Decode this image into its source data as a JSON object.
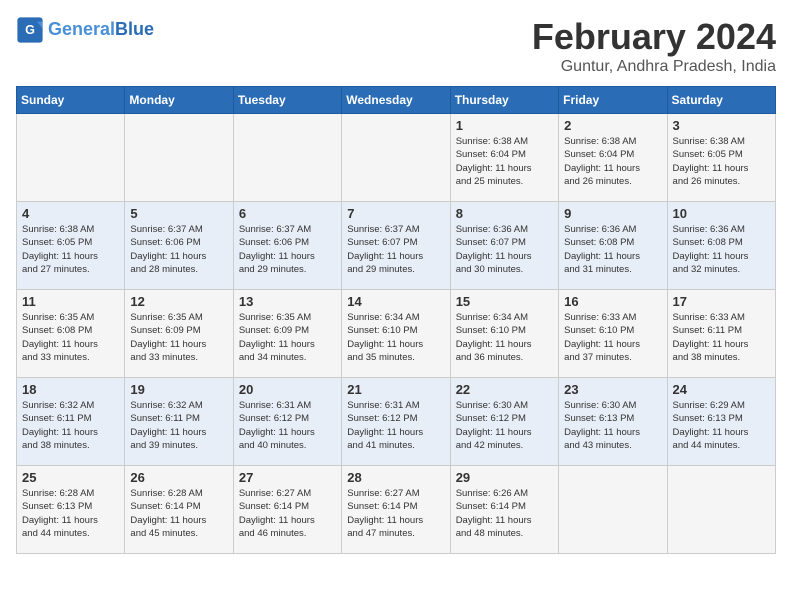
{
  "logo": {
    "text_general": "General",
    "text_blue": "Blue"
  },
  "title": "February 2024",
  "subtitle": "Guntur, Andhra Pradesh, India",
  "weekdays": [
    "Sunday",
    "Monday",
    "Tuesday",
    "Wednesday",
    "Thursday",
    "Friday",
    "Saturday"
  ],
  "weeks": [
    [
      {
        "day": "",
        "info": ""
      },
      {
        "day": "",
        "info": ""
      },
      {
        "day": "",
        "info": ""
      },
      {
        "day": "",
        "info": ""
      },
      {
        "day": "1",
        "info": "Sunrise: 6:38 AM\nSunset: 6:04 PM\nDaylight: 11 hours\nand 25 minutes."
      },
      {
        "day": "2",
        "info": "Sunrise: 6:38 AM\nSunset: 6:04 PM\nDaylight: 11 hours\nand 26 minutes."
      },
      {
        "day": "3",
        "info": "Sunrise: 6:38 AM\nSunset: 6:05 PM\nDaylight: 11 hours\nand 26 minutes."
      }
    ],
    [
      {
        "day": "4",
        "info": "Sunrise: 6:38 AM\nSunset: 6:05 PM\nDaylight: 11 hours\nand 27 minutes."
      },
      {
        "day": "5",
        "info": "Sunrise: 6:37 AM\nSunset: 6:06 PM\nDaylight: 11 hours\nand 28 minutes."
      },
      {
        "day": "6",
        "info": "Sunrise: 6:37 AM\nSunset: 6:06 PM\nDaylight: 11 hours\nand 29 minutes."
      },
      {
        "day": "7",
        "info": "Sunrise: 6:37 AM\nSunset: 6:07 PM\nDaylight: 11 hours\nand 29 minutes."
      },
      {
        "day": "8",
        "info": "Sunrise: 6:36 AM\nSunset: 6:07 PM\nDaylight: 11 hours\nand 30 minutes."
      },
      {
        "day": "9",
        "info": "Sunrise: 6:36 AM\nSunset: 6:08 PM\nDaylight: 11 hours\nand 31 minutes."
      },
      {
        "day": "10",
        "info": "Sunrise: 6:36 AM\nSunset: 6:08 PM\nDaylight: 11 hours\nand 32 minutes."
      }
    ],
    [
      {
        "day": "11",
        "info": "Sunrise: 6:35 AM\nSunset: 6:08 PM\nDaylight: 11 hours\nand 33 minutes."
      },
      {
        "day": "12",
        "info": "Sunrise: 6:35 AM\nSunset: 6:09 PM\nDaylight: 11 hours\nand 33 minutes."
      },
      {
        "day": "13",
        "info": "Sunrise: 6:35 AM\nSunset: 6:09 PM\nDaylight: 11 hours\nand 34 minutes."
      },
      {
        "day": "14",
        "info": "Sunrise: 6:34 AM\nSunset: 6:10 PM\nDaylight: 11 hours\nand 35 minutes."
      },
      {
        "day": "15",
        "info": "Sunrise: 6:34 AM\nSunset: 6:10 PM\nDaylight: 11 hours\nand 36 minutes."
      },
      {
        "day": "16",
        "info": "Sunrise: 6:33 AM\nSunset: 6:10 PM\nDaylight: 11 hours\nand 37 minutes."
      },
      {
        "day": "17",
        "info": "Sunrise: 6:33 AM\nSunset: 6:11 PM\nDaylight: 11 hours\nand 38 minutes."
      }
    ],
    [
      {
        "day": "18",
        "info": "Sunrise: 6:32 AM\nSunset: 6:11 PM\nDaylight: 11 hours\nand 38 minutes."
      },
      {
        "day": "19",
        "info": "Sunrise: 6:32 AM\nSunset: 6:11 PM\nDaylight: 11 hours\nand 39 minutes."
      },
      {
        "day": "20",
        "info": "Sunrise: 6:31 AM\nSunset: 6:12 PM\nDaylight: 11 hours\nand 40 minutes."
      },
      {
        "day": "21",
        "info": "Sunrise: 6:31 AM\nSunset: 6:12 PM\nDaylight: 11 hours\nand 41 minutes."
      },
      {
        "day": "22",
        "info": "Sunrise: 6:30 AM\nSunset: 6:12 PM\nDaylight: 11 hours\nand 42 minutes."
      },
      {
        "day": "23",
        "info": "Sunrise: 6:30 AM\nSunset: 6:13 PM\nDaylight: 11 hours\nand 43 minutes."
      },
      {
        "day": "24",
        "info": "Sunrise: 6:29 AM\nSunset: 6:13 PM\nDaylight: 11 hours\nand 44 minutes."
      }
    ],
    [
      {
        "day": "25",
        "info": "Sunrise: 6:28 AM\nSunset: 6:13 PM\nDaylight: 11 hours\nand 44 minutes."
      },
      {
        "day": "26",
        "info": "Sunrise: 6:28 AM\nSunset: 6:14 PM\nDaylight: 11 hours\nand 45 minutes."
      },
      {
        "day": "27",
        "info": "Sunrise: 6:27 AM\nSunset: 6:14 PM\nDaylight: 11 hours\nand 46 minutes."
      },
      {
        "day": "28",
        "info": "Sunrise: 6:27 AM\nSunset: 6:14 PM\nDaylight: 11 hours\nand 47 minutes."
      },
      {
        "day": "29",
        "info": "Sunrise: 6:26 AM\nSunset: 6:14 PM\nDaylight: 11 hours\nand 48 minutes."
      },
      {
        "day": "",
        "info": ""
      },
      {
        "day": "",
        "info": ""
      }
    ]
  ]
}
